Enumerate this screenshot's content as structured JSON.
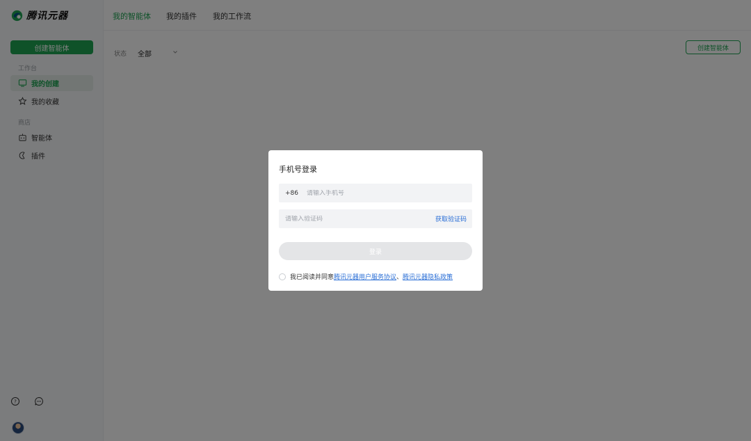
{
  "app": {
    "logo_text": "腾讯元器"
  },
  "sidebar": {
    "create_button": "创建智能体",
    "section_workbench": "工作台",
    "my_created": "我的创建",
    "my_favorites": "我的收藏",
    "section_store": "商店",
    "agents": "智能体",
    "plugins": "插件"
  },
  "topbar": {
    "tabs": [
      "我的智能体",
      "我的插件",
      "我的工作流"
    ]
  },
  "main": {
    "filter_label": "状态",
    "filter_value": "全部",
    "create_button": "创建智能体"
  },
  "modal": {
    "title": "手机号登录",
    "phone_prefix": "+86",
    "phone_placeholder": "请输入手机号",
    "code_placeholder": "请输入验证码",
    "get_code": "获取验证码",
    "login_button": "登录",
    "agree_text": "我已阅读并同意",
    "terms_link": "腾讯元器用户服务协议",
    "separator": "、",
    "privacy_link": "腾讯元器隐私政策"
  },
  "colors": {
    "accent": "#1fa453",
    "link": "#2b6fd6",
    "overlay": "rgba(0,0,0,0.5)"
  }
}
